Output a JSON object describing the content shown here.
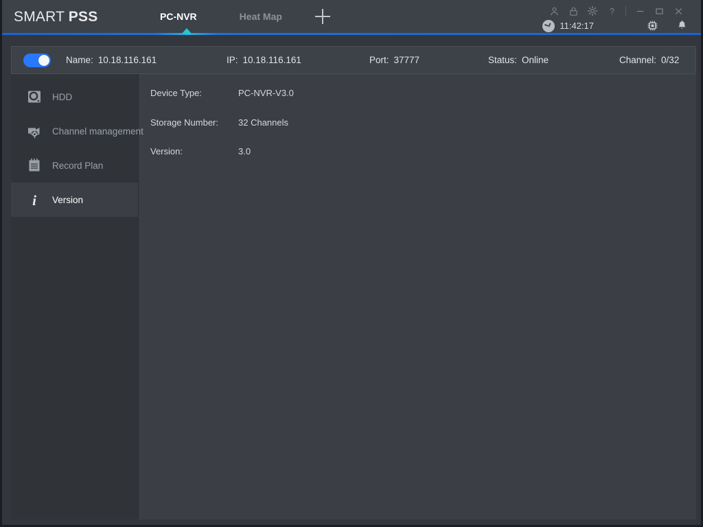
{
  "app": {
    "logo_primary": "SMART ",
    "logo_bold": "PSS"
  },
  "titlebar": {
    "tabs": [
      {
        "label": "PC-NVR",
        "active": true
      },
      {
        "label": "Heat Map",
        "active": false
      }
    ],
    "add_tab_icon": "plus-icon",
    "system_icons": [
      "user-icon",
      "lock-icon",
      "gear-icon",
      "help-icon",
      "minimize-icon",
      "maximize-icon",
      "close-icon"
    ],
    "clock_icon": "clock-icon",
    "clock_time": "11:42:17",
    "chip_icon": "cpu-chip-icon",
    "bell_icon": "bell-icon",
    "accent_color": "#1565d8",
    "active_tab_marker_color": "#26c6da"
  },
  "device_bar": {
    "toggle_enabled": true,
    "toggle_color": "#2979ff",
    "fields": [
      {
        "label": "Name:",
        "value": "10.18.116.161"
      },
      {
        "label": "IP:",
        "value": "10.18.116.161"
      },
      {
        "label": "Port:",
        "value": "37777"
      },
      {
        "label": "Status:",
        "value": "Online"
      },
      {
        "label": "Channel:",
        "value": "0/32"
      }
    ]
  },
  "sidebar": {
    "items": [
      {
        "label": "HDD",
        "icon": "hdd-icon",
        "active": false
      },
      {
        "label": "Channel management",
        "icon": "camera-settings-icon",
        "active": false
      },
      {
        "label": "Record Plan",
        "icon": "notepad-icon",
        "active": false
      },
      {
        "label": "Version",
        "icon": "info-icon",
        "active": true
      }
    ]
  },
  "main": {
    "rows": [
      {
        "label": "Device Type:",
        "value": "PC-NVR-V3.0"
      },
      {
        "label": "Storage Number:",
        "value": "32 Channels"
      },
      {
        "label": "Version:",
        "value": "3.0"
      }
    ]
  }
}
